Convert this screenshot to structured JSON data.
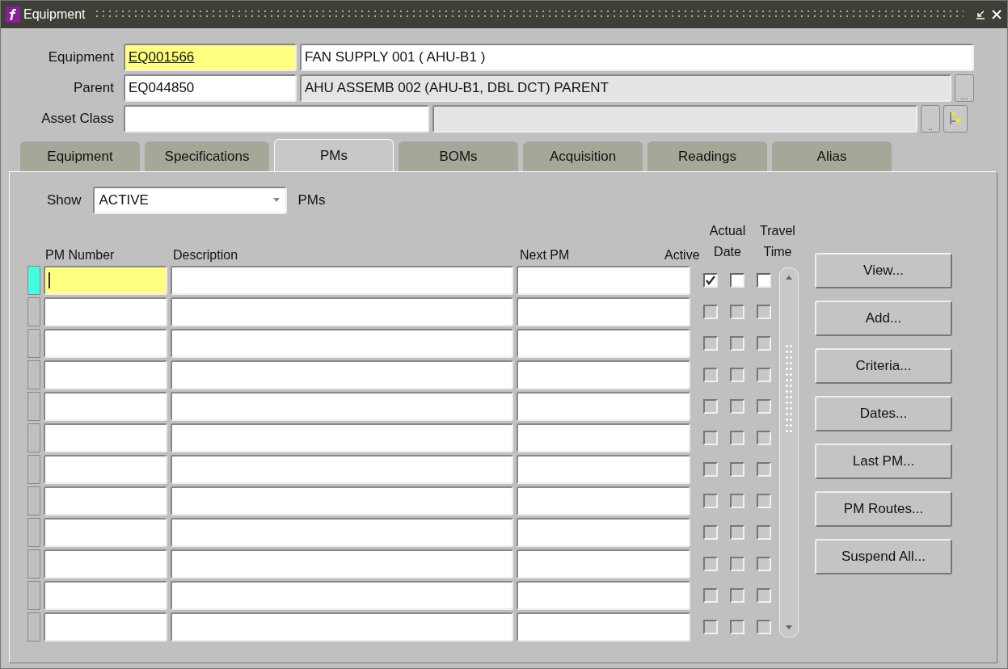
{
  "window": {
    "title": "Equipment"
  },
  "header": {
    "equipment": {
      "label": "Equipment",
      "code": "EQ001566",
      "description": "FAN SUPPLY 001 ( AHU-B1 )"
    },
    "parent": {
      "label": "Parent",
      "code": "EQ044850",
      "description": "AHU ASSEMB 002 (AHU-B1, DBL DCT) PARENT",
      "lov_button": "..."
    },
    "asset_class": {
      "label": "Asset Class",
      "lov_button": ".."
    }
  },
  "tabs": [
    {
      "label": "Equipment",
      "selected": false
    },
    {
      "label": "Specifications",
      "selected": false
    },
    {
      "label": "PMs",
      "selected": true
    },
    {
      "label": "BOMs",
      "selected": false
    },
    {
      "label": "Acquisition",
      "selected": false
    },
    {
      "label": "Readings",
      "selected": false
    },
    {
      "label": "Alias",
      "selected": false
    }
  ],
  "show": {
    "label": "Show",
    "value": "ACTIVE",
    "suffix": "PMs"
  },
  "table": {
    "columns": [
      "PM Number",
      "Description",
      "Next PM",
      "Active",
      "Actual Date",
      "Travel Time"
    ],
    "rows": [
      {
        "selected": true,
        "disabled": false,
        "active": true,
        "actual_date": false,
        "travel_time": false
      },
      {
        "selected": false,
        "disabled": true,
        "active": false,
        "actual_date": false,
        "travel_time": false
      },
      {
        "selected": false,
        "disabled": true,
        "active": false,
        "actual_date": false,
        "travel_time": false
      },
      {
        "selected": false,
        "disabled": true,
        "active": false,
        "actual_date": false,
        "travel_time": false
      },
      {
        "selected": false,
        "disabled": true,
        "active": false,
        "actual_date": false,
        "travel_time": false
      },
      {
        "selected": false,
        "disabled": true,
        "active": false,
        "actual_date": false,
        "travel_time": false
      },
      {
        "selected": false,
        "disabled": true,
        "active": false,
        "actual_date": false,
        "travel_time": false
      },
      {
        "selected": false,
        "disabled": true,
        "active": false,
        "actual_date": false,
        "travel_time": false
      },
      {
        "selected": false,
        "disabled": true,
        "active": false,
        "actual_date": false,
        "travel_time": false
      },
      {
        "selected": false,
        "disabled": true,
        "active": false,
        "actual_date": false,
        "travel_time": false
      },
      {
        "selected": false,
        "disabled": true,
        "active": false,
        "actual_date": false,
        "travel_time": false
      },
      {
        "selected": false,
        "disabled": true,
        "active": false,
        "actual_date": false,
        "travel_time": false
      }
    ]
  },
  "buttons": [
    "View...",
    "Add...",
    "Criteria...",
    "Dates...",
    "Last PM...",
    "PM Routes...",
    "Suspend All..."
  ]
}
